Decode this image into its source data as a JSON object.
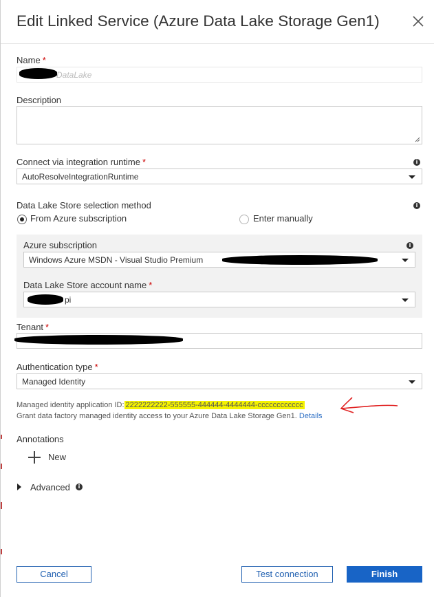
{
  "header": {
    "title": "Edit Linked Service (Azure Data Lake Storage Gen1)",
    "close_icon": "close-icon"
  },
  "name_field": {
    "label": "Name",
    "required_mark": "*",
    "value_suffix": "DataLake"
  },
  "description_field": {
    "label": "Description",
    "value": ""
  },
  "integration_runtime": {
    "label": "Connect via integration runtime",
    "required_mark": "*",
    "value": "AutoResolveIntegrationRuntime"
  },
  "selection_method": {
    "label": "Data Lake Store selection method",
    "options": [
      "From Azure subscription",
      "Enter manually"
    ],
    "selected": "From Azure subscription"
  },
  "azure_subscription": {
    "label": "Azure subscription",
    "value": "Windows Azure  MSDN - Visual Studio Premium"
  },
  "account_name": {
    "label": "Data Lake Store account name",
    "required_mark": "*",
    "value_suffix": "pi"
  },
  "tenant": {
    "label": "Tenant",
    "required_mark": "*",
    "value": ""
  },
  "auth_type": {
    "label": "Authentication type",
    "required_mark": "*",
    "value": "Managed Identity"
  },
  "managed_identity": {
    "prefix": "Managed identity application ID:",
    "app_id": "2222222222-555555-444444-4444444-cccccccccccc",
    "grant_text": "Grant data factory managed identity access to your Azure Data Lake Storage Gen1.",
    "details_link": "Details"
  },
  "annotations": {
    "label": "Annotations",
    "new_label": "New"
  },
  "advanced": {
    "label": "Advanced"
  },
  "footer": {
    "cancel_label": "Cancel",
    "test_label": "Test connection",
    "finish_label": "Finish"
  },
  "colors": {
    "accent": "#1864c6",
    "required": "#cc0000",
    "highlight": "#f4f200",
    "annotation_arrow": "#e02020"
  }
}
